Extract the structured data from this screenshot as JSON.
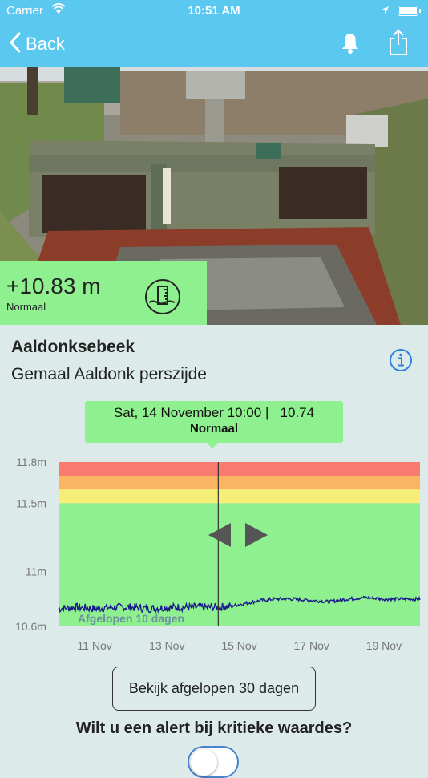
{
  "status_bar": {
    "carrier": "Carrier",
    "time": "10:51 AM",
    "icons": [
      "wifi-icon",
      "location-arrow-icon",
      "battery-icon"
    ]
  },
  "nav": {
    "back_label": "Back",
    "icons": [
      "chevron-left-icon",
      "bell-icon",
      "share-icon"
    ],
    "bar_color": "#5bc8ef"
  },
  "level": {
    "value": "+10.83 m",
    "status": "Normaal",
    "icon": "water-gauge-icon",
    "color": "#8ef08e"
  },
  "location": {
    "river": "Aaldonksebeek",
    "station": "Gemaal Aaldonk perszijde",
    "info_icon": "info-icon"
  },
  "tooltip": {
    "datetime": "Sat, 14 November 10:00",
    "separator": "|",
    "value": "10.74",
    "status": "Normaal"
  },
  "chart_data": {
    "type": "line",
    "caption": "Afgelopen 10 dagen",
    "x_labels": [
      "11 Nov",
      "13 Nov",
      "15 Nov",
      "17 Nov",
      "19 Nov"
    ],
    "y_labels": [
      "11.8m",
      "11.5m",
      "11m",
      "10.6m"
    ],
    "y_ticks": [
      11.8,
      11.5,
      11.0,
      10.6
    ],
    "ylim": [
      10.6,
      11.8
    ],
    "xlim": [
      10,
      20
    ],
    "cursor_x": 14.42,
    "bands": [
      {
        "from": 10.6,
        "to": 11.5,
        "color": "#8ef08e"
      },
      {
        "from": 11.5,
        "to": 11.6,
        "color": "#f7ee78"
      },
      {
        "from": 11.6,
        "to": 11.7,
        "color": "#fbb461"
      },
      {
        "from": 11.7,
        "to": 11.8,
        "color": "#f77b6e"
      }
    ],
    "series": [
      {
        "color": "#1a1a8c",
        "points": [
          [
            10.0,
            10.73
          ],
          [
            10.5,
            10.74
          ],
          [
            11.0,
            10.73
          ],
          [
            11.5,
            10.74
          ],
          [
            12.0,
            10.74
          ],
          [
            12.5,
            10.73
          ],
          [
            13.0,
            10.74
          ],
          [
            13.5,
            10.74
          ],
          [
            14.0,
            10.74
          ],
          [
            14.42,
            10.74
          ],
          [
            14.8,
            10.75
          ],
          [
            15.2,
            10.77
          ],
          [
            15.6,
            10.79
          ],
          [
            16.0,
            10.8
          ],
          [
            16.5,
            10.8
          ],
          [
            17.0,
            10.79
          ],
          [
            17.5,
            10.78
          ],
          [
            18.0,
            10.8
          ],
          [
            18.5,
            10.81
          ],
          [
            19.0,
            10.8
          ],
          [
            19.5,
            10.8
          ],
          [
            20.0,
            10.8
          ]
        ]
      }
    ],
    "nav_icons": [
      "arrow-left-icon",
      "arrow-right-icon"
    ]
  },
  "actions": {
    "history_button": "Bekijk afgelopen 30 dagen",
    "alert_question": "Wilt u een alert bij kritieke waardes?",
    "alert_toggle_on": false
  }
}
